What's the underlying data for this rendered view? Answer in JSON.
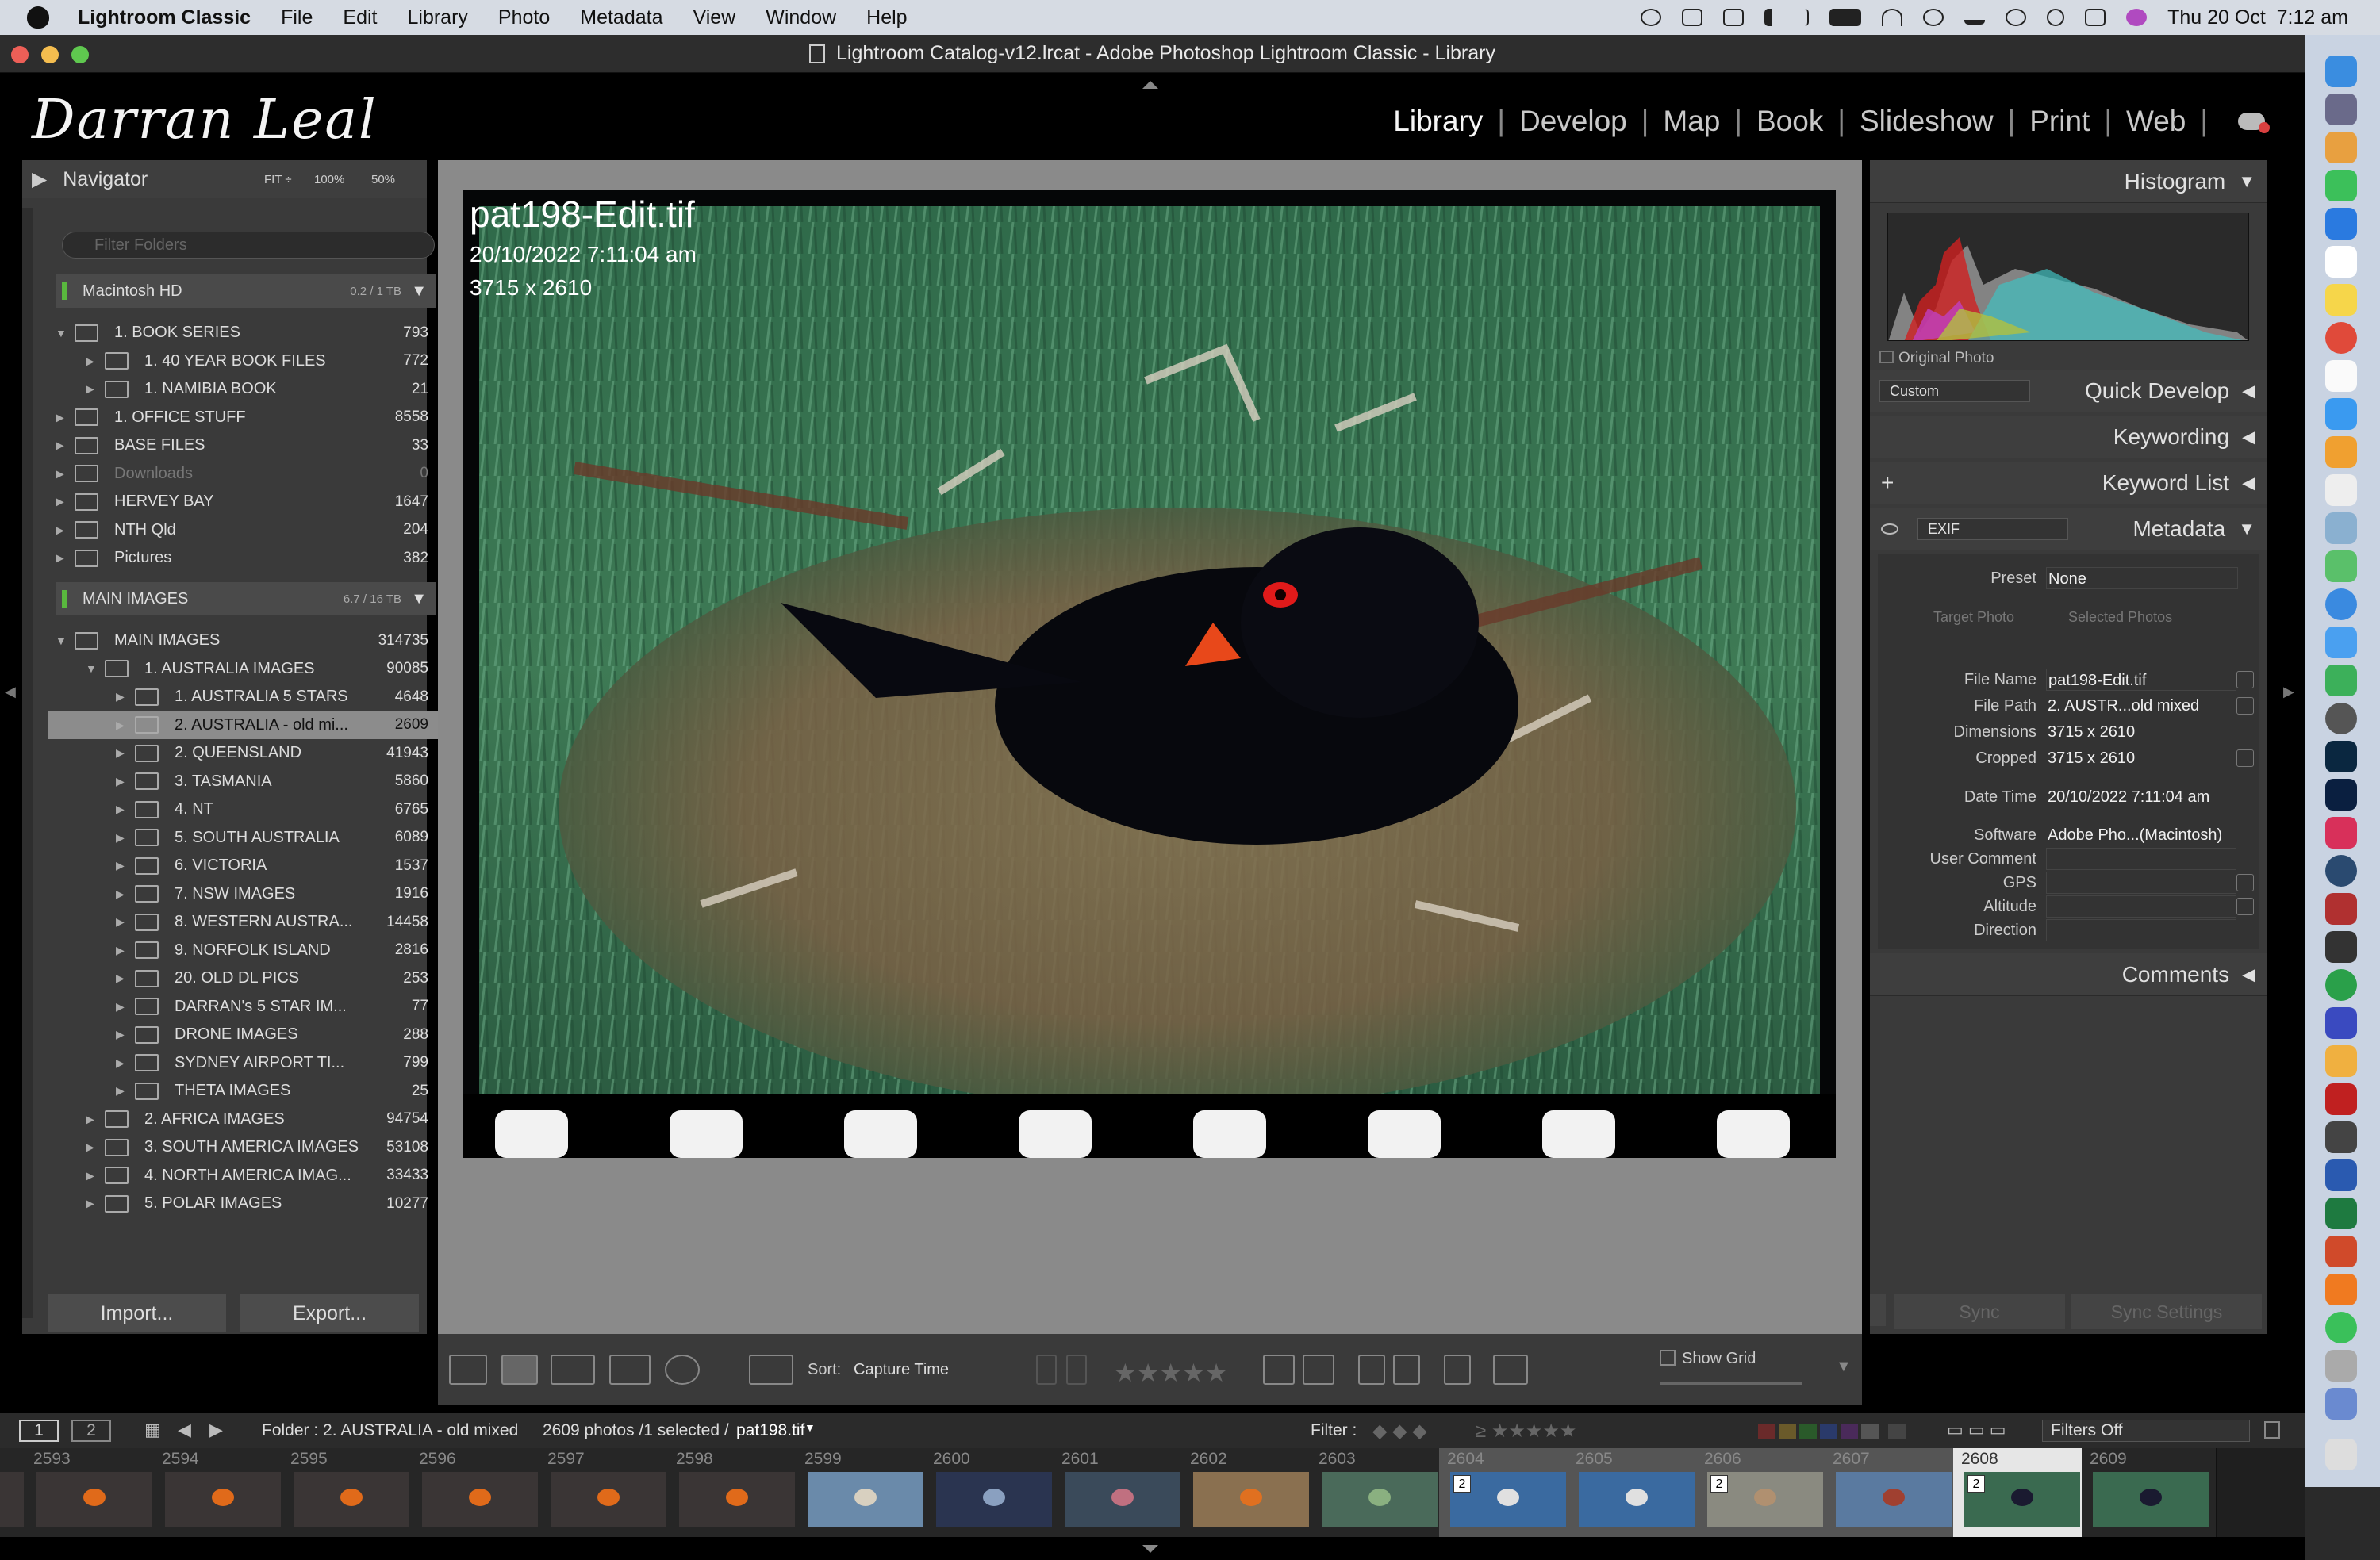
{
  "menubar": {
    "app": "Lightroom Classic",
    "menus": [
      "File",
      "Edit",
      "Library",
      "Photo",
      "Metadata",
      "View",
      "Window",
      "Help"
    ],
    "clock": "Thu 20 Oct  7:12 am"
  },
  "window": {
    "title": "Lightroom Catalog-v12.lrcat - Adobe Photoshop Lightroom Classic - Library"
  },
  "identity_plate": "Darran Leal",
  "modules": [
    "Library",
    "Develop",
    "Map",
    "Book",
    "Slideshow",
    "Print",
    "Web"
  ],
  "active_module": "Library",
  "navigator": {
    "title": "Navigator",
    "fit": "FIT ÷",
    "z1": "100%",
    "z2": "50%"
  },
  "folders": {
    "filter_placeholder": "Filter Folders",
    "volume1": {
      "name": "Macintosh HD",
      "capacity": "0.2 / 1 TB"
    },
    "volume2": {
      "name": "MAIN IMAGES",
      "capacity": "6.7 / 16 TB"
    },
    "rows1": [
      {
        "name": "1. BOOK SERIES",
        "count": "793",
        "level": 0,
        "open": true
      },
      {
        "name": "1. 40 YEAR BOOK FILES",
        "count": "772",
        "level": 1
      },
      {
        "name": "1. NAMIBIA BOOK",
        "count": "21",
        "level": 1
      },
      {
        "name": "1. OFFICE STUFF",
        "count": "8558",
        "level": 0
      },
      {
        "name": "BASE FILES",
        "count": "33",
        "level": 0
      },
      {
        "name": "Downloads",
        "count": "0",
        "level": 0,
        "dim": true
      },
      {
        "name": "HERVEY BAY",
        "count": "1647",
        "level": 0
      },
      {
        "name": "NTH Qld",
        "count": "204",
        "level": 0
      },
      {
        "name": "Pictures",
        "count": "382",
        "level": 0
      }
    ],
    "rows2": [
      {
        "name": "MAIN IMAGES",
        "count": "314735",
        "level": 0,
        "open": true
      },
      {
        "name": "1. AUSTRALIA IMAGES",
        "count": "90085",
        "level": 1,
        "open": true
      },
      {
        "name": "1. AUSTRALIA 5 STARS",
        "count": "4648",
        "level": 2
      },
      {
        "name": "2. AUSTRALIA - old mi...",
        "count": "2609",
        "level": 2,
        "selected": true
      },
      {
        "name": "2. QUEENSLAND",
        "count": "41943",
        "level": 2
      },
      {
        "name": "3. TASMANIA",
        "count": "5860",
        "level": 2
      },
      {
        "name": "4. NT",
        "count": "6765",
        "level": 2
      },
      {
        "name": "5. SOUTH AUSTRALIA",
        "count": "6089",
        "level": 2
      },
      {
        "name": "6. VICTORIA",
        "count": "1537",
        "level": 2
      },
      {
        "name": "7. NSW IMAGES",
        "count": "1916",
        "level": 2
      },
      {
        "name": "8. WESTERN AUSTRA...",
        "count": "14458",
        "level": 2
      },
      {
        "name": "9. NORFOLK ISLAND",
        "count": "2816",
        "level": 2
      },
      {
        "name": "20. OLD DL PICS",
        "count": "253",
        "level": 2
      },
      {
        "name": "DARRAN's 5 STAR IM...",
        "count": "77",
        "level": 2
      },
      {
        "name": "DRONE IMAGES",
        "count": "288",
        "level": 2
      },
      {
        "name": "SYDNEY AIRPORT TI...",
        "count": "799",
        "level": 2
      },
      {
        "name": "THETA IMAGES",
        "count": "25",
        "level": 2
      },
      {
        "name": "2. AFRICA IMAGES",
        "count": "94754",
        "level": 1
      },
      {
        "name": "3. SOUTH AMERICA IMAGES",
        "count": "53108",
        "level": 1
      },
      {
        "name": "4. NORTH AMERICA IMAG...",
        "count": "33433",
        "level": 1
      },
      {
        "name": "5. POLAR IMAGES",
        "count": "10277",
        "level": 1
      }
    ]
  },
  "buttons": {
    "import": "Import...",
    "export": "Export..."
  },
  "loupe": {
    "filename": "pat198-Edit.tif",
    "datetime": "20/10/2022 7:11:04 am",
    "dimensions": "3715 x 2610"
  },
  "toolbar": {
    "sort_label": "Sort:",
    "sort_value": "Capture Time",
    "show_grid": "Show Grid",
    "stars": "★★★★★"
  },
  "right": {
    "histogram": "Histogram",
    "original_photo": "Original Photo",
    "quick_develop": "Quick Develop",
    "qd_preset": "Custom",
    "keywording": "Keywording",
    "keyword_list": "Keyword List",
    "metadata": "Metadata",
    "metadata_set": "EXIF",
    "preset_label": "Preset",
    "preset_value": "None",
    "target_photo": "Target Photo",
    "selected_photos": "Selected Photos",
    "fields": [
      {
        "label": "File Name",
        "value": "pat198-Edit.tif",
        "box": true
      },
      {
        "label": "File Path",
        "value": "2. AUSTR...old mixed"
      },
      {
        "label": "Dimensions",
        "value": "3715 x 2610"
      },
      {
        "label": "Cropped",
        "value": "3715 x 2610"
      },
      {
        "label": "Date Time",
        "value": "20/10/2022 7:11:04 am"
      },
      {
        "label": "Software",
        "value": "Adobe Pho...(Macintosh)"
      },
      {
        "label": "User Comment",
        "value": "",
        "box": true
      },
      {
        "label": "GPS",
        "value": "",
        "box": true
      },
      {
        "label": "Altitude",
        "value": "",
        "box": true
      },
      {
        "label": "Direction",
        "value": "",
        "box": true
      }
    ],
    "comments": "Comments",
    "sync": "Sync",
    "sync_settings": "Sync Settings"
  },
  "filmbar": {
    "page1": "1",
    "page2": "2",
    "folder": "Folder : 2. AUSTRALIA - old mixed",
    "count": "2609 photos /1 selected /",
    "selected_file": "pat198.tif",
    "filter_label": "Filter :",
    "filters_off": "Filters Off"
  },
  "filmstrip": [
    {
      "num": "",
      "type": "sunset"
    },
    {
      "num": "2593",
      "type": "sunset"
    },
    {
      "num": "2594",
      "type": "sunset"
    },
    {
      "num": "2595",
      "type": "sunset"
    },
    {
      "num": "2596",
      "type": "sunset"
    },
    {
      "num": "2597",
      "type": "sunset"
    },
    {
      "num": "2598",
      "type": "sunset"
    },
    {
      "num": "2599",
      "type": "beach"
    },
    {
      "num": "2600",
      "type": "portrait"
    },
    {
      "num": "2601",
      "type": "seal"
    },
    {
      "num": "2602",
      "type": "crab"
    },
    {
      "num": "2603",
      "type": "frog"
    },
    {
      "num": "2604",
      "type": "bird",
      "stack": "2",
      "hl": true
    },
    {
      "num": "2605",
      "type": "bird",
      "hl": true
    },
    {
      "num": "2606",
      "type": "field",
      "stack": "2",
      "hl": true
    },
    {
      "num": "2607",
      "type": "cattle",
      "hl": true
    },
    {
      "num": "2608",
      "type": "nest",
      "stack": "2",
      "selected": true
    },
    {
      "num": "2609",
      "type": "nest"
    }
  ],
  "colors": {
    "accent_green": "#59b83e",
    "panel": "#3a3a3a",
    "selected_row": "#8c8c8c"
  }
}
